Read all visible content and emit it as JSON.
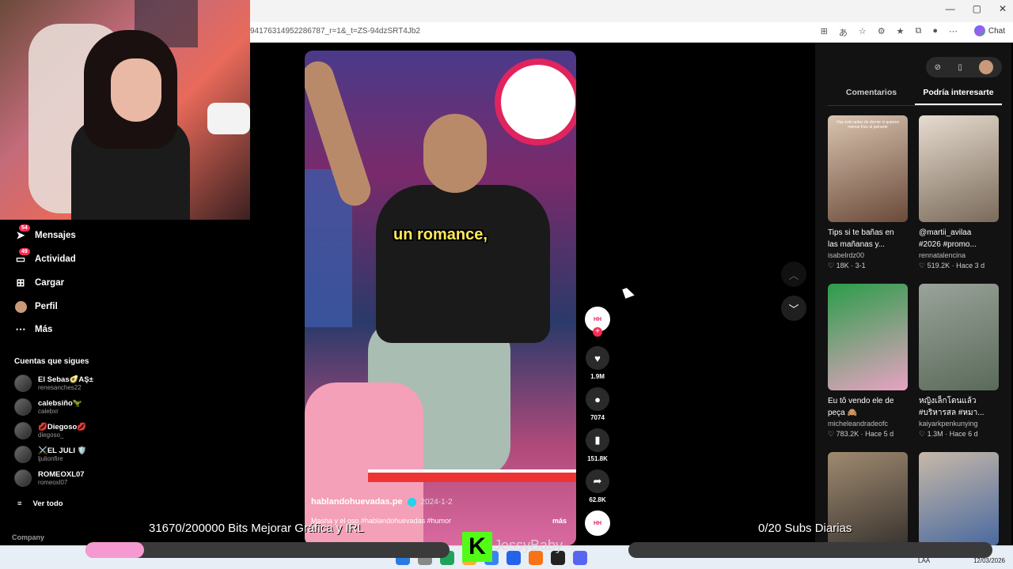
{
  "browser": {
    "url": "94176314952286787_r=1&_t=ZS-94dzSRT4Jb2",
    "chat_label": "Chat"
  },
  "sidebar": {
    "items": [
      {
        "label": "Mensajes",
        "badge": "54",
        "icon": "paper-plane-icon"
      },
      {
        "label": "Actividad",
        "badge": "49",
        "icon": "inbox-icon"
      },
      {
        "label": "Cargar",
        "badge": "",
        "icon": "plus-square-icon"
      },
      {
        "label": "Perfil",
        "badge": "",
        "icon": "profile-avatar-icon"
      },
      {
        "label": "Más",
        "badge": "",
        "icon": "ellipsis-icon"
      }
    ],
    "following_title": "Cuentas que sigues",
    "following": [
      {
        "name": "El Sebas🥑AŞ±",
        "handle": "renesanches22"
      },
      {
        "name": "calebsiño🦖",
        "handle": "calebxr"
      },
      {
        "name": "💋Diegoso💋",
        "handle": "diegoso_"
      },
      {
        "name": "⚔️EL JULI 🛡️",
        "handle": "ljulionfire"
      },
      {
        "name": "ROMEOXL07",
        "handle": "romeoxl07"
      }
    ],
    "see_all": "Ver todo",
    "company": "Company"
  },
  "video": {
    "subtitle": "un romance,",
    "author": "hablandohuevadas.pe",
    "date": "2024-1-2",
    "caption": "Masha y el oso #hablandohuevadas #humor",
    "more": "más"
  },
  "actions": {
    "likes": "1.9M",
    "comments": "7074",
    "saves": "151.8K",
    "shares": "62.8K"
  },
  "right_panel": {
    "tabs": [
      "Comentarios",
      "Podría interesarte"
    ],
    "active_tab": 1,
    "cards": [
      {
        "title": "Tips si te bañas en las mañanas y...",
        "author": "isabelrdz00",
        "likes": "18K",
        "age": "3-1",
        "thumb_text": "Haz esto antes de dormir si quieres menos frizz al peinarte",
        "colors": [
          "#d9c4b0",
          "#6b4a3a"
        ]
      },
      {
        "title": "@martii_avilaa #2026 #promo...",
        "author": "rennatalencina",
        "likes": "519.2K",
        "age": "Hace 3 d",
        "thumb_text": "",
        "colors": [
          "#e6dccf",
          "#7a6a5a"
        ]
      },
      {
        "title": "Eu tô vendo ele de peça 🙈",
        "author": "micheleandradeofc",
        "likes": "783.2K",
        "age": "Hace 5 d",
        "thumb_text": "",
        "colors": [
          "#2a9d4a",
          "#e7a3c2"
        ]
      },
      {
        "title": "หญิงเล็กโดนแล้ว #บริหารสล #หมา...",
        "author": "kaiyarkpenkunying",
        "likes": "1.3M",
        "age": "Hace 6 d",
        "thumb_text": "",
        "colors": [
          "#9aa39a",
          "#5a6a5a"
        ]
      },
      {
        "title": "",
        "author": "",
        "likes": "",
        "age": "",
        "thumb_text": "",
        "colors": [
          "#a08a70",
          "#3a3530"
        ]
      },
      {
        "title": "",
        "author": "",
        "likes": "",
        "age": "",
        "thumb_text": "",
        "colors": [
          "#c7b8a8",
          "#4a6aa0"
        ]
      }
    ]
  },
  "overlay": {
    "bits_goal": "31670/200000 Bits Mejorar Gráfica y IRL",
    "bits_progress": 0.158,
    "subs_goal": "0/20 Subs Diarias",
    "subs_progress": 0,
    "streamer_name": "JessyBaby",
    "kick_letter": "K"
  },
  "taskbar": {
    "lang": "LAA",
    "date": "12/03/2026"
  },
  "colors": {
    "accent": "#fe2c55",
    "kick_green": "#53fc18",
    "subtitle_yellow": "#ffe95a"
  }
}
